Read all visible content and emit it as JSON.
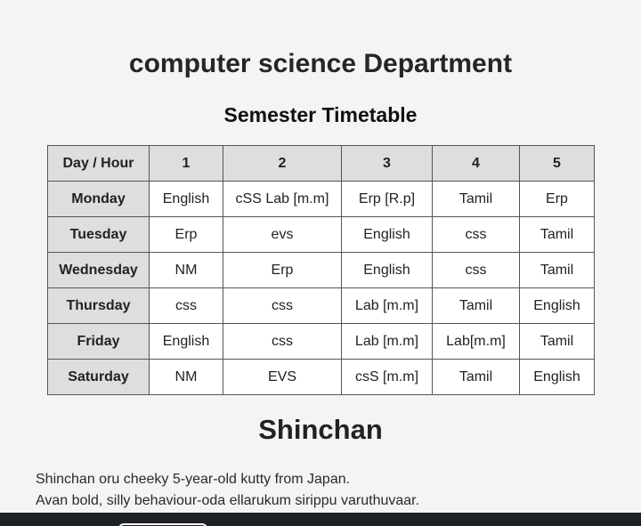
{
  "header": {
    "department_title": "computer science Department",
    "timetable_title": "Semester Timetable"
  },
  "timetable": {
    "headers": [
      "Day / Hour",
      "1",
      "2",
      "3",
      "4",
      "5"
    ],
    "rows": [
      {
        "day": "Monday",
        "cells": [
          "English",
          "cSS Lab [m.m]",
          "Erp [R.p]",
          "Tamil",
          "Erp"
        ]
      },
      {
        "day": "Tuesday",
        "cells": [
          "Erp",
          "evs",
          "English",
          "css",
          "Tamil"
        ]
      },
      {
        "day": "Wednesday",
        "cells": [
          "NM",
          "Erp",
          "English",
          "css",
          "Tamil"
        ]
      },
      {
        "day": "Thursday",
        "cells": [
          "css",
          "css",
          "Lab [m.m]",
          "Tamil",
          "English"
        ]
      },
      {
        "day": "Friday",
        "cells": [
          "English",
          "css",
          "Lab [m.m]",
          "Lab[m.m]",
          "Tamil"
        ]
      },
      {
        "day": "Saturday",
        "cells": [
          "NM",
          "EVS",
          "csS [m.m]",
          "Tamil",
          "English"
        ]
      }
    ]
  },
  "shinchan": {
    "title": "Shinchan",
    "lines": [
      "Shinchan oru cheeky 5-year-old kutty from Japan.",
      "Avan bold, silly behaviour-oda ellarukum sirippu varuthuvaar."
    ]
  },
  "colors": {
    "background": "#f4f4f4",
    "header_cell": "#dedede",
    "bottom_bar": "#1e2227"
  }
}
